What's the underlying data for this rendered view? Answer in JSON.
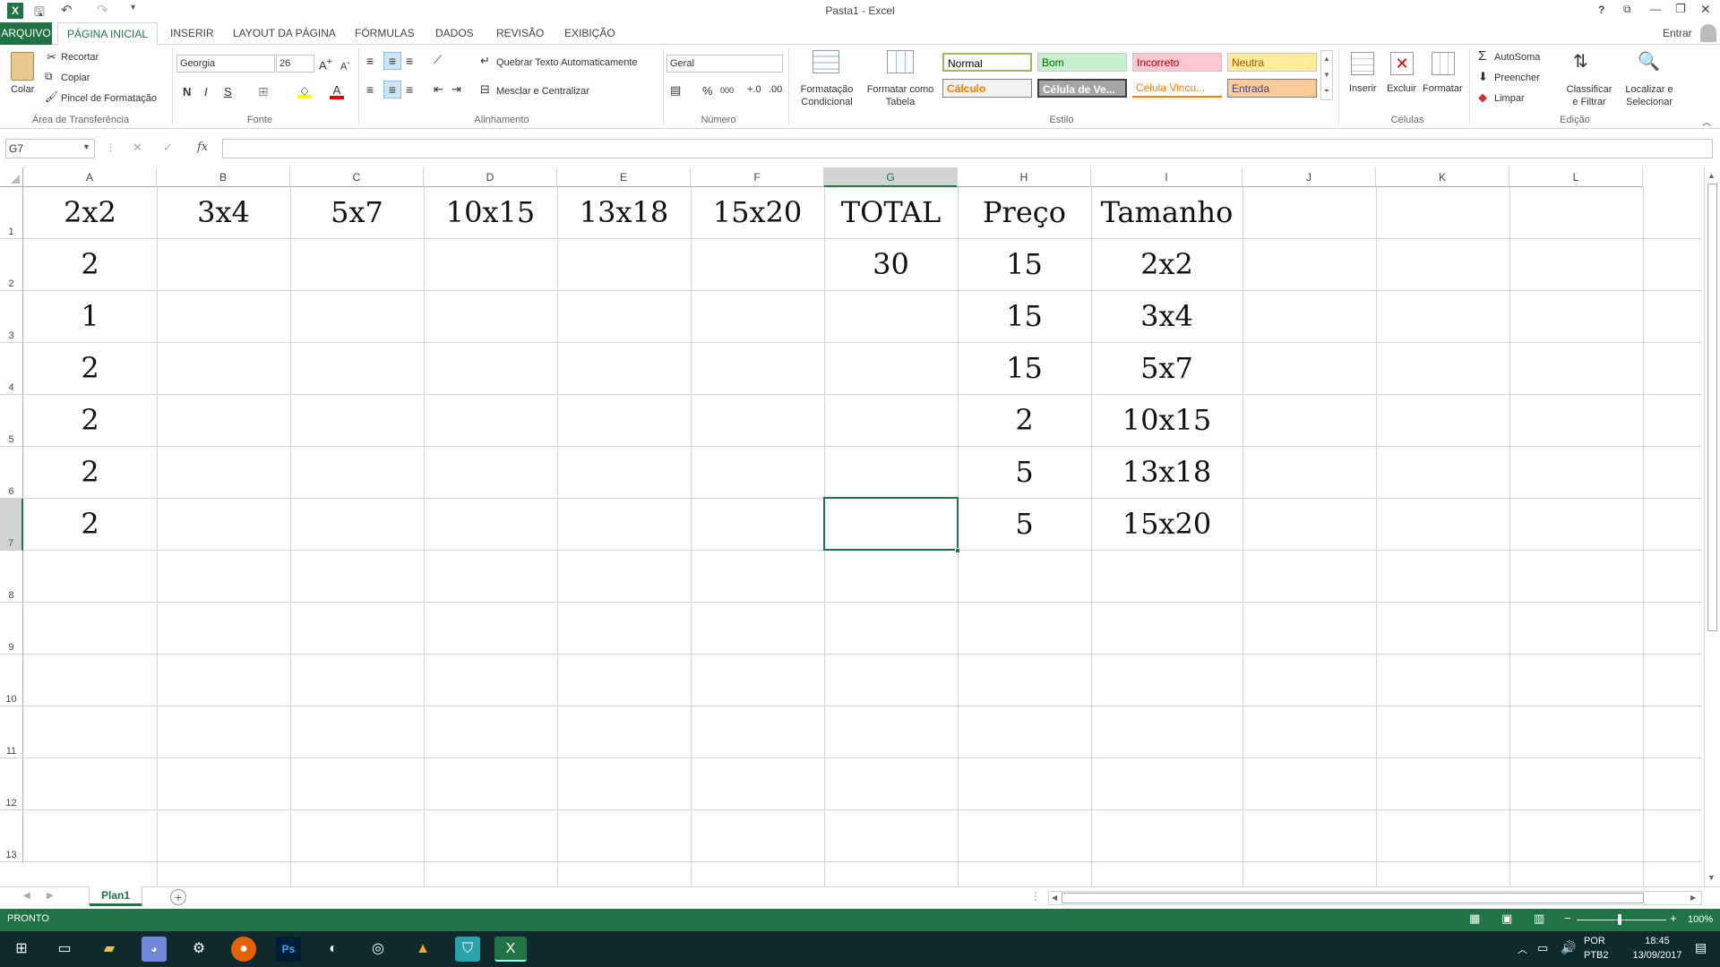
{
  "title_bar": {
    "title": "Pasta1 - Excel",
    "help": "?",
    "controls": [
      "?",
      "⧉",
      "—",
      "❐",
      "✕"
    ]
  },
  "tabs": [
    "ARQUIVO",
    "PÁGINA INICIAL",
    "INSERIR",
    "LAYOUT DA PÁGINA",
    "FÓRMULAS",
    "DADOS",
    "REVISÃO",
    "EXIBIÇÃO"
  ],
  "account": {
    "signin": "Entrar"
  },
  "ribbon": {
    "clipboard": {
      "paste": "Colar",
      "cut": "Recortar",
      "copy": "Copiar",
      "format_painter": "Pincel de Formatação",
      "label": "Área de Transferência"
    },
    "font": {
      "name": "Georgia",
      "size": "26",
      "bold": "N",
      "italic": "I",
      "underline": "S",
      "label": "Fonte"
    },
    "alignment": {
      "wrap": "Quebrar Texto Automaticamente",
      "merge": "Mesclar e Centralizar",
      "label": "Alinhamento"
    },
    "number": {
      "format": "Geral",
      "percent": "%",
      "thousands": "000",
      "label": "Número"
    },
    "styles": {
      "conditional": [
        "Formatação",
        "Condicional"
      ],
      "as_table": [
        "Formatar como",
        "Tabela"
      ],
      "items": [
        {
          "name": "Normal",
          "bg": "#ffffff",
          "fg": "#000000"
        },
        {
          "name": "Bom",
          "bg": "#c6efce",
          "fg": "#006100"
        },
        {
          "name": "Incorreto",
          "bg": "#ffc7ce",
          "fg": "#9c0006"
        },
        {
          "name": "Neutra",
          "bg": "#ffeb9c",
          "fg": "#9c5700"
        },
        {
          "name": "Cálculo",
          "bg": "#f2f2f2",
          "fg": "#fa7d00"
        },
        {
          "name": "Célula de Ve...",
          "bg": "#a5a5a5",
          "fg": "#ffffff"
        },
        {
          "name": "Célula Vincu...",
          "bg": "#ffffff",
          "fg": "#fa7d00"
        },
        {
          "name": "Entrada",
          "bg": "#ffcc99",
          "fg": "#3f3f76"
        }
      ],
      "label": "Estilo"
    },
    "cells": {
      "insert": "Inserir",
      "delete": "Excluir",
      "format": "Formatar",
      "label": "Células"
    },
    "editing": {
      "autosum": "AutoSoma",
      "fill": "Preencher",
      "clear": "Limpar",
      "sort": [
        "Classificar",
        "e Filtrar"
      ],
      "find": [
        "Localizar e",
        "Selecionar"
      ],
      "label": "Edição"
    }
  },
  "formula_bar": {
    "name_box": "G7",
    "fx": "fx",
    "value": ""
  },
  "columns": [
    "A",
    "B",
    "C",
    "D",
    "E",
    "F",
    "G",
    "H",
    "I",
    "J",
    "K",
    "L"
  ],
  "rows": [
    "1",
    "2",
    "3",
    "4",
    "5",
    "6",
    "7",
    "8",
    "9",
    "10",
    "11",
    "12",
    "13"
  ],
  "cells": {
    "A1": "2x2",
    "B1": "3x4",
    "C1": "5x7",
    "D1": "10x15",
    "E1": "13x18",
    "F1": "15x20",
    "G1": "TOTAL",
    "H1": "Preço",
    "I1": "Tamanho",
    "A2": "2",
    "G2": "30",
    "H2": "15",
    "I2": "2x2",
    "A3": "1",
    "H3": "15",
    "I3": "3x4",
    "A4": "2",
    "H4": "15",
    "I4": "5x7",
    "A5": "2",
    "H5": "2",
    "I5": "10x15",
    "A6": "2",
    "H6": "5",
    "I6": "13x18",
    "A7": "2",
    "H7": "5",
    "I7": "15x20"
  },
  "sheet_tabs": {
    "active": "Plan1",
    "add": "+"
  },
  "status_bar": {
    "mode": "PRONTO",
    "zoom": "100%"
  },
  "taskbar": {
    "lang": "POR",
    "layout": "PTB2",
    "time": "18:45",
    "date": "13/09/2017"
  }
}
